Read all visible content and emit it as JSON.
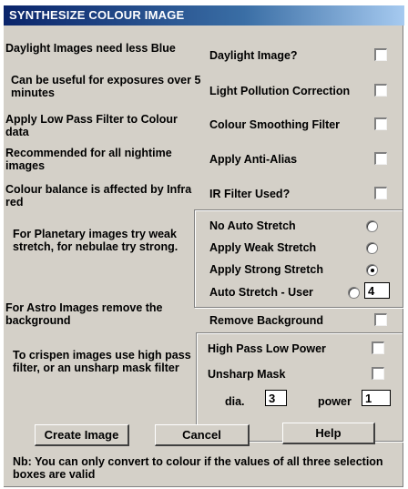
{
  "window": {
    "title": "SYNTHESIZE COLOUR IMAGE"
  },
  "hints": {
    "daylight": "Daylight Images need less Blue",
    "light_pollution": "Can be useful for exposures over 5 minutes",
    "low_pass": "Apply Low Pass Filter to Colour data",
    "anti_alias": "Recommended for all nightime images",
    "ir": "Colour balance is affected by Infra red",
    "stretch": "For Planetary images try weak stretch, for nebulae try strong.",
    "background": "For Astro Images remove the background",
    "crispen": "To crispen images use high pass filter, or an unsharp mask filter"
  },
  "options": {
    "daylight_image": {
      "label": "Daylight Image?",
      "checked": false
    },
    "light_pollution": {
      "label": "Light Pollution Correction",
      "checked": false
    },
    "colour_smoothing": {
      "label": "Colour Smoothing Filter",
      "checked": false
    },
    "anti_alias": {
      "label": "Apply Anti-Alias",
      "checked": false
    },
    "ir_filter": {
      "label": "IR Filter Used?",
      "checked": false
    },
    "remove_background": {
      "label": "Remove Background",
      "checked": false
    },
    "high_pass": {
      "label": "High Pass Low Power",
      "checked": false
    },
    "unsharp_mask": {
      "label": "Unsharp Mask",
      "checked": false
    }
  },
  "stretch": {
    "no_auto": "No Auto Stretch",
    "weak": "Apply Weak Stretch",
    "strong": "Apply Strong Stretch",
    "user": "Auto Stretch - User",
    "selected": "strong",
    "user_value": "4"
  },
  "unsharp": {
    "dia_label": "dia.",
    "dia_value": "3",
    "power_label": "power",
    "power_value": "1"
  },
  "buttons": {
    "create": "Create Image",
    "cancel": "Cancel",
    "help": "Help"
  },
  "note": "Nb: You can only convert to colour if the values of all three selection boxes are valid"
}
